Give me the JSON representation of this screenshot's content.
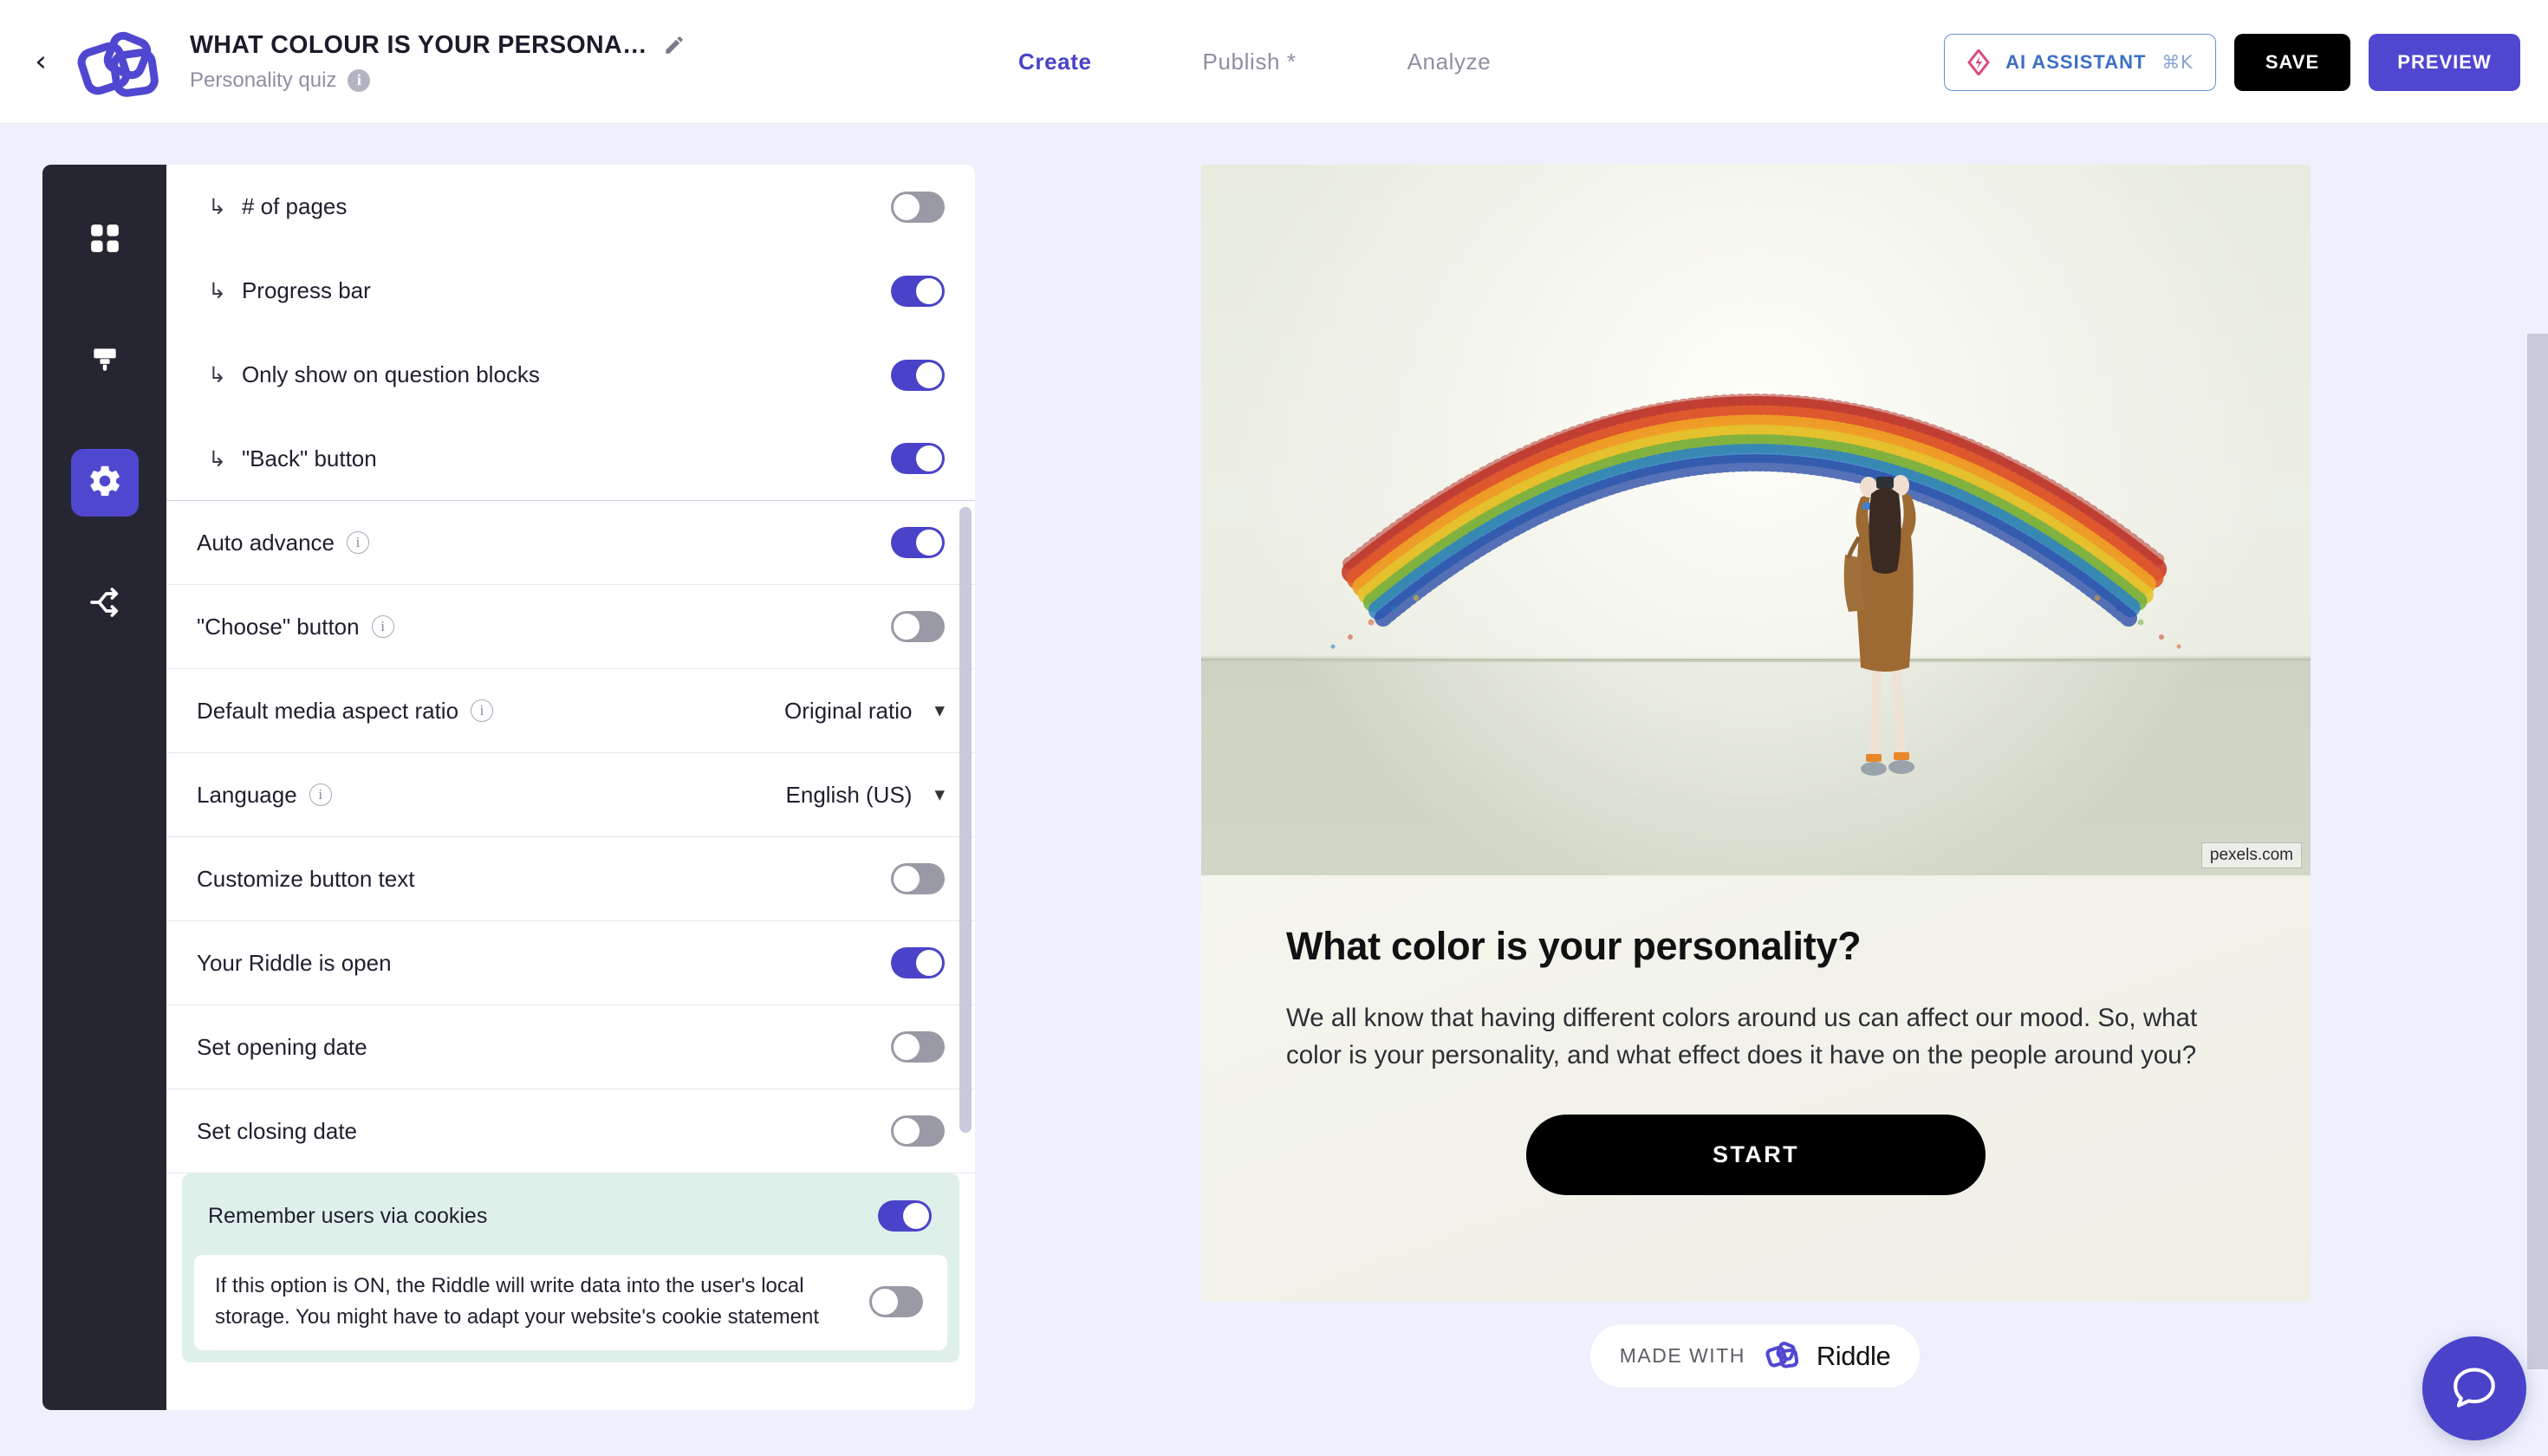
{
  "header": {
    "back_icon": "chevron-left-icon",
    "logo": "riddle-logo",
    "quiz_title": "WHAT COLOUR IS YOUR PERSONA…",
    "edit_icon": "pencil-icon",
    "quiz_type": "Personality quiz",
    "info_icon": "info-icon",
    "tabs": [
      {
        "label": "Create",
        "active": true
      },
      {
        "label": "Publish *",
        "active": false
      },
      {
        "label": "Analyze",
        "active": false
      }
    ],
    "ai_assistant": {
      "label": "AI ASSISTANT",
      "shortcut": "⌘K",
      "icon": "ai-diamond-icon"
    },
    "save_label": "SAVE",
    "preview_label": "PREVIEW"
  },
  "rail": {
    "items": [
      {
        "name": "blocks-grid-icon",
        "active": false
      },
      {
        "name": "paint-brush-icon",
        "active": false
      },
      {
        "name": "gear-icon",
        "active": true
      },
      {
        "name": "share-nodes-icon",
        "active": false
      }
    ]
  },
  "settings": {
    "rows": [
      {
        "label": "# of pages",
        "sub": true,
        "control": "toggle",
        "value": "off"
      },
      {
        "label": "Progress bar",
        "sub": true,
        "control": "toggle",
        "value": "on"
      },
      {
        "label": "Only show on question blocks",
        "sub": true,
        "control": "toggle",
        "value": "on"
      },
      {
        "label": "\"Back\" button",
        "sub": true,
        "control": "toggle",
        "value": "on"
      },
      {
        "label": "Auto advance",
        "sub": false,
        "control": "toggle",
        "value": "on",
        "info": true
      },
      {
        "label": "\"Choose\" button",
        "sub": false,
        "control": "toggle",
        "value": "off",
        "info": true
      },
      {
        "label": "Default media aspect ratio",
        "sub": false,
        "control": "select",
        "value": "Original ratio",
        "info": true
      },
      {
        "label": "Language",
        "sub": false,
        "control": "select",
        "value": "English (US)",
        "info": true
      },
      {
        "label": "Customize button text",
        "sub": false,
        "control": "toggle",
        "value": "off"
      },
      {
        "label": "Your Riddle is open",
        "sub": false,
        "control": "toggle",
        "value": "on"
      },
      {
        "label": "Set opening date",
        "sub": false,
        "control": "toggle",
        "value": "off"
      },
      {
        "label": "Set closing date",
        "sub": false,
        "control": "toggle",
        "value": "off"
      }
    ],
    "cookies": {
      "label": "Remember users via cookies",
      "toggle": "on",
      "note_text": "If this option is ON, the Riddle will write data into the user's local storage. You might have to adapt your website's cookie statement",
      "note_toggle": "off",
      "highlight_color": "#dff0ea"
    }
  },
  "preview": {
    "image_credit": "pexels.com",
    "image_alt": "woman photographing a rainbow art installation on a gallery wall",
    "title": "What color is your personality?",
    "description": "We all know that having different colors around us can affect our mood. So, what color is your personality, and what effect does it have on the people around you?",
    "start_label": "START",
    "badge_prefix": "MADE WITH",
    "badge_brand": "Riddle"
  },
  "chat": {
    "icon": "chat-bubble-icon"
  },
  "colors": {
    "page_background": "#eef0fd",
    "accent_indigo": "#4a43c9",
    "preview_button": "#5047d1",
    "rail_dark": "#262632",
    "toggle_on": "#4a43c9",
    "toggle_off": "#9a9aa6",
    "cookie_highlight": "#dff0ea",
    "ai_border": "#6b8fd6",
    "ai_text": "#3b6fc4"
  }
}
